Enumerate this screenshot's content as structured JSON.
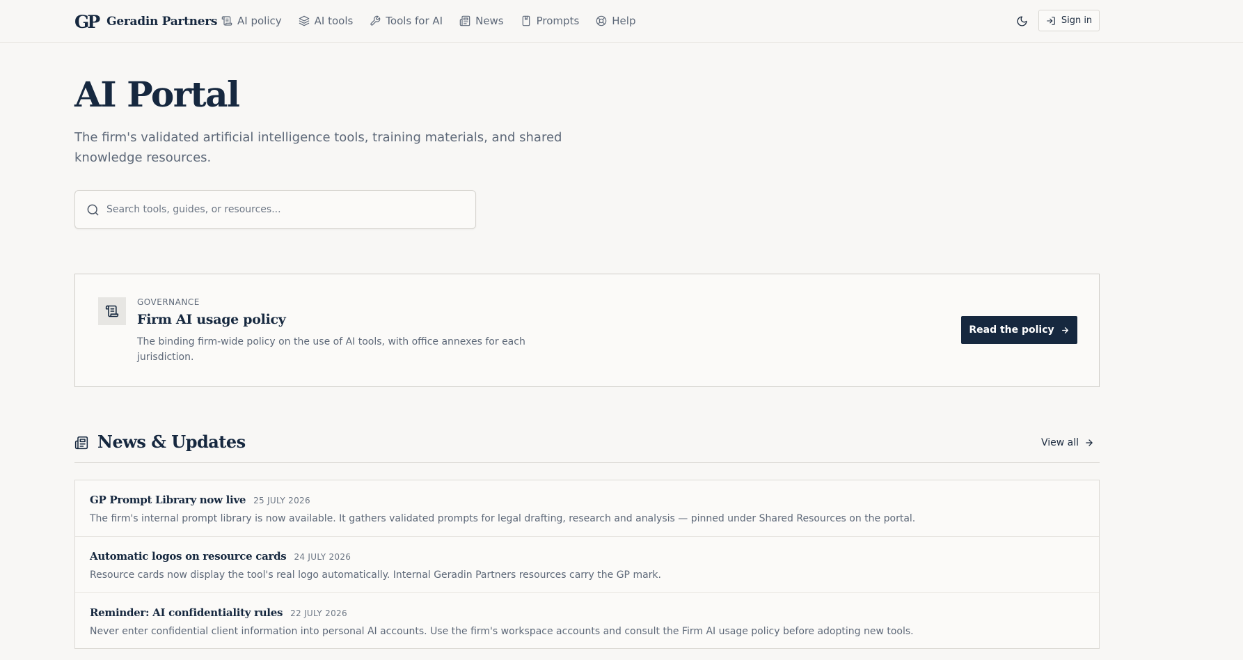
{
  "brand": {
    "mark": "GP",
    "name": "Geradin Partners"
  },
  "nav": [
    {
      "label": "AI policy",
      "icon": "scroll-icon"
    },
    {
      "label": "AI tools",
      "icon": "layers-icon"
    },
    {
      "label": "Tools for AI",
      "icon": "wrench-icon"
    },
    {
      "label": "News",
      "icon": "newspaper-icon"
    },
    {
      "label": "Prompts",
      "icon": "bookmark-book-icon"
    },
    {
      "label": "Help",
      "icon": "lifebuoy-icon"
    }
  ],
  "header": {
    "theme_icon": "moon-icon",
    "signin_label": "Sign in"
  },
  "hero": {
    "title": "AI Portal",
    "subtitle": "The firm's validated artificial intelligence tools, training materials, and shared knowledge resources."
  },
  "search": {
    "placeholder": "Search tools, guides, or resources...",
    "value": ""
  },
  "policy": {
    "eyebrow": "GOVERNANCE",
    "title": "Firm AI usage policy",
    "description": "The binding firm-wide policy on the use of AI tools, with office annexes for each jurisdiction.",
    "button_label": "Read the policy"
  },
  "news": {
    "title": "News & Updates",
    "view_all_label": "View all",
    "items": [
      {
        "title": "GP Prompt Library now live",
        "date": "25 JULY 2026",
        "body": "The firm's internal prompt library is now available. It gathers validated prompts for legal drafting, research and analysis — pinned under Shared Resources on the portal."
      },
      {
        "title": "Automatic logos on resource cards",
        "date": "24 JULY 2026",
        "body": "Resource cards now display the tool's real logo automatically. Internal Geradin Partners resources carry the GP mark."
      },
      {
        "title": "Reminder: AI confidentiality rules",
        "date": "22 JULY 2026",
        "body": "Never enter confidential client information into personal AI accounts. Use the firm's workspace accounts and consult the Firm AI usage policy before adopting new tools."
      }
    ]
  },
  "colors": {
    "navy": "#16283f",
    "muted": "#5d6878",
    "background": "#f8f7f5"
  }
}
